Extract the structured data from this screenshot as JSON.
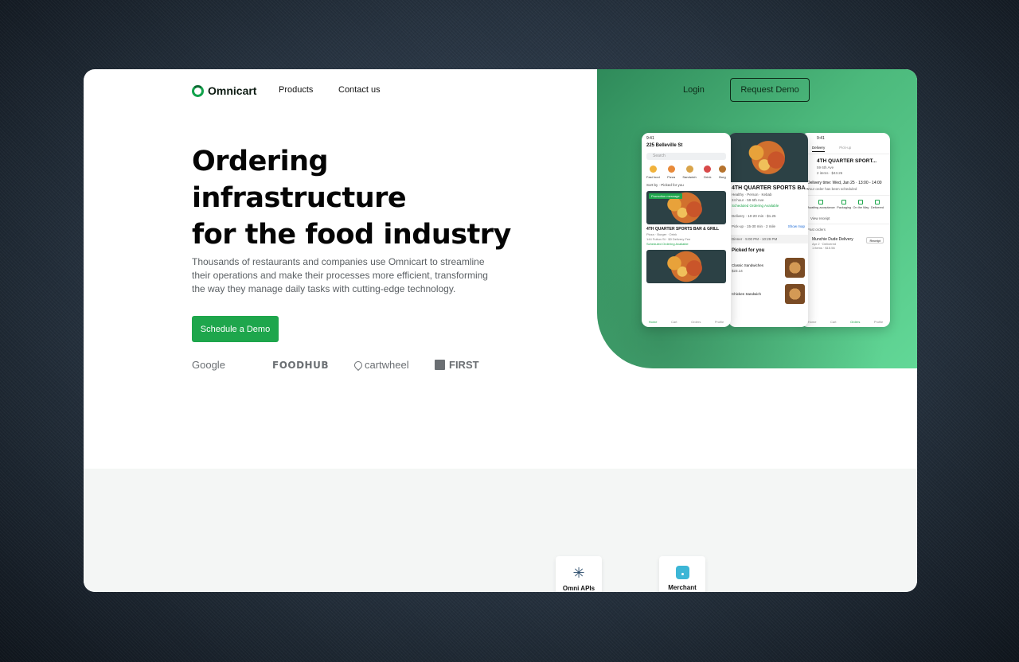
{
  "brand": {
    "name": "Omnicart",
    "accent": "#1ea64c",
    "panel_color": "#4cb97c"
  },
  "nav": {
    "products": "Products",
    "contact": "Contact us",
    "login": "Login",
    "request_demo": "Request Demo"
  },
  "hero": {
    "title_line1": "Ordering",
    "title_line2": "infrastructure",
    "title_line3": "for the food industry",
    "description": "Thousands of restaurants and companies use Omnicart to streamline their operations and make their processes more efficient, transforming the way they manage daily tasks with cutting-edge technology.",
    "cta": "Schedule a Demo"
  },
  "partners": [
    "Google",
    "FOODHUB",
    "cartwheel",
    "FIRST"
  ],
  "cards": [
    {
      "label": "Omni APIs",
      "icon": "asterisk-icon"
    },
    {
      "label": "Merchant",
      "icon": "merchant-icon"
    }
  ],
  "phone1": {
    "time": "9:41",
    "address": "225 Belleville St",
    "search": "Search",
    "categories": [
      "Fast food",
      "Pizza",
      "Sandwich",
      "Drink",
      "Burg"
    ],
    "sort": "Sort by · Picked for you",
    "promo": "Promotion message",
    "restaurant": "4TH QUARTER SPORTS BAR & GRILL",
    "sub1": "Pizza · Burger · Drink",
    "sub2": "144 Fulton St · $0 Delivery Fee",
    "status": "Scheduled Ordering Available",
    "tabs": [
      "Home",
      "Cart",
      "Orders",
      "Profile"
    ]
  },
  "phone2": {
    "title": "4TH QUARTER SPORTS BA...",
    "line1": "Healthy · Person · Kebab",
    "line2": "24 hour · 59 6th Ave",
    "status": "Scheduled Ordering Available",
    "delivery": "Delivery · 10-20 min · $1.25",
    "pickup": "Pick-up · 15-30 min · 2 mile",
    "show_map": "Show map",
    "dinner": "Dinner · 5:00 PM - 10:29 PM",
    "section": "Picked for you",
    "item1": "Classic Sandwiches",
    "item1_price": "$23.14",
    "item2": "Chicken Sandwich"
  },
  "phone3": {
    "time": "9:41",
    "tab_delivery": "Delivery",
    "tab_pickup": "Pick-up",
    "title": "4TH QUARTER SPORT...",
    "addr": "59 6th Ave",
    "items": "2 items · $43.26",
    "time_line": "Delivery time: Wed, Jan 25 · 13:00 - 14:00",
    "scheduled": "Your order has been scheduled",
    "steps": [
      "Awaiting acceptance",
      "Packaging",
      "On the Way",
      "Delivered"
    ],
    "receipt": "View receipt",
    "past": "Past orders",
    "order_name": "Munchie Dude Delivery",
    "order_sub": "Apr 2 · Delivered",
    "order_items": "1 items · $15.56",
    "receipt_btn": "Receipt",
    "tabs": [
      "Home",
      "Cart",
      "Orders",
      "Profile"
    ]
  }
}
